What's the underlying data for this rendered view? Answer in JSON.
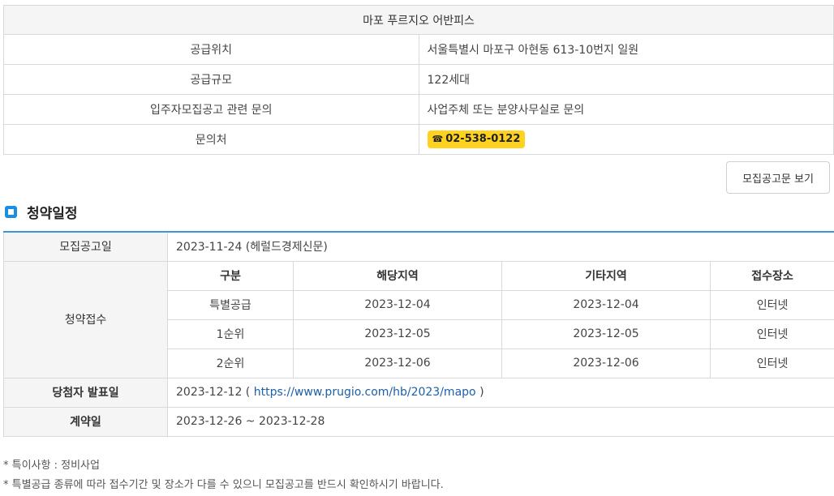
{
  "info": {
    "title": "마포 푸르지오 어반피스",
    "rows": [
      {
        "label": "공급위치",
        "value": "서울특별시 마포구 아현동 613-10번지 일원"
      },
      {
        "label": "공급규모",
        "value": "122세대"
      },
      {
        "label": "입주자모집공고 관련 문의",
        "value": "사업주체 또는 분양사무실로 문의"
      },
      {
        "label": "문의처",
        "value": "02-538-0122"
      }
    ],
    "phone_icon": "☎"
  },
  "notice_button": "모집공고문 보기",
  "section": {
    "title": "청약일정",
    "icon": "square-bullet-icon"
  },
  "schedule": {
    "announce_label": "모집공고일",
    "announce_value": "2023-11-24 (헤럴드경제신문)",
    "apply_label": "청약접수",
    "columns": [
      "구분",
      "해당지역",
      "기타지역",
      "접수장소"
    ],
    "rows": [
      [
        "특별공급",
        "2023-12-04",
        "2023-12-04",
        "인터넷"
      ],
      [
        "1순위",
        "2023-12-05",
        "2023-12-05",
        "인터넷"
      ],
      [
        "2순위",
        "2023-12-06",
        "2023-12-06",
        "인터넷"
      ]
    ],
    "winner_label": "당첨자 발표일",
    "winner_date": "2023-12-12 (",
    "winner_link": "https://www.prugio.com/hb/2023/mapo",
    "winner_close": ")",
    "contract_label": "계약일",
    "contract_value": "2023-12-26 ~ 2023-12-28"
  },
  "notes": [
    "* 특이사항 : 정비사업",
    "* 특별공급 종류에 따라 접수기간 및 장소가 다를 수 있으니 모집공고를 반드시 확인하시기 바랍니다."
  ],
  "colors": {
    "accent": "#3d96d8",
    "badge": "#ffd21f",
    "link": "#1d5fa8"
  }
}
